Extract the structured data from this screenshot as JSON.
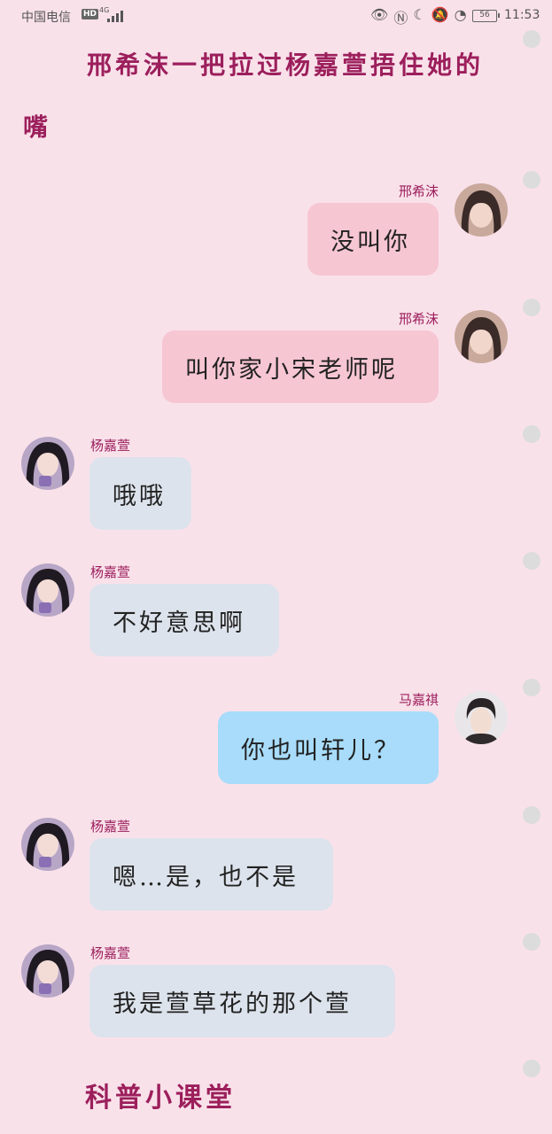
{
  "status_bar": {
    "carrier": "中国电信",
    "hd": "HD",
    "network": "4G",
    "battery": "56",
    "time": "11:53",
    "icons": [
      "eye-icon",
      "nfc-icon",
      "moon-icon",
      "mute-bell-icon",
      "speed-icon"
    ]
  },
  "story": {
    "title_line1": "邢希沫一把拉过杨嘉萱捂住她的",
    "title_line2": "嘴",
    "footer": "科普小课堂"
  },
  "messages": [
    {
      "side": "right",
      "sender": "邢希沫",
      "text": "没叫你",
      "style": "pink"
    },
    {
      "side": "right",
      "sender": "邢希沫",
      "text": "叫你家小宋老师呢",
      "style": "pink"
    },
    {
      "side": "left",
      "sender": "杨嘉萱",
      "text": "哦哦",
      "style": "gray"
    },
    {
      "side": "left",
      "sender": "杨嘉萱",
      "text": "不好意思啊",
      "style": "gray"
    },
    {
      "side": "right",
      "sender": "马嘉祺",
      "text": "你也叫轩儿？",
      "style": "blue"
    },
    {
      "side": "left",
      "sender": "杨嘉萱",
      "text": "嗯…是，也不是",
      "style": "gray"
    },
    {
      "side": "left",
      "sender": "杨嘉萱",
      "text": "我是萱草花的那个萱",
      "style": "gray"
    }
  ]
}
